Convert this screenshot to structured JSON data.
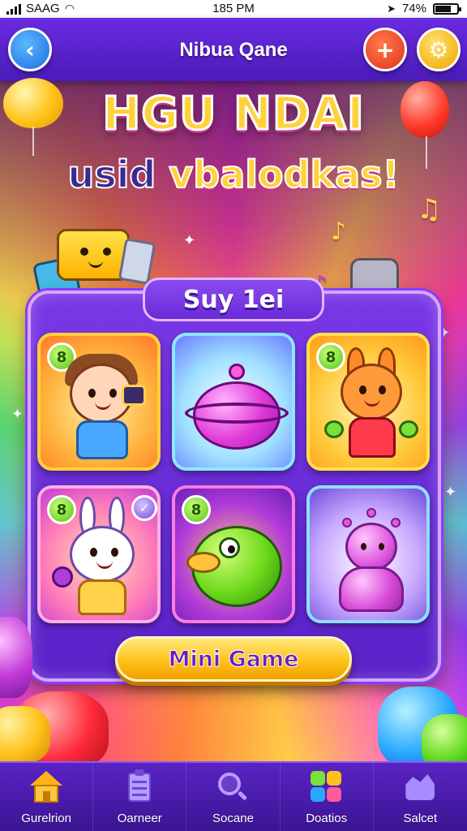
{
  "status_bar": {
    "carrier": "SAAG",
    "time": "185 PM",
    "battery": "74%",
    "battery_level": 0.74
  },
  "header": {
    "title": "Nibua Qane",
    "back_icon": "chevron-left-icon",
    "plus_icon": "plus-icon",
    "settings_icon": "gear-icon"
  },
  "banner": {
    "headline": "HGU NDAI",
    "subline_part1": "usid",
    "subline_part2": "vbalodkas!"
  },
  "panel": {
    "title": "Suy 1ei",
    "tiles": [
      {
        "badge": "8",
        "character": "kid-with-camera"
      },
      {
        "badge": "",
        "character": "magenta-pot"
      },
      {
        "badge": "8",
        "character": "orange-fox"
      },
      {
        "badge": "8",
        "character": "white-bunny"
      },
      {
        "badge": "8",
        "character": "green-dino"
      },
      {
        "badge": "",
        "character": "purple-blob"
      }
    ],
    "action_label": "Mini Game"
  },
  "bottom_nav": {
    "items": [
      {
        "label": "Gurelrion",
        "icon": "home-icon"
      },
      {
        "label": "Oarneer",
        "icon": "clipboard-icon"
      },
      {
        "label": "Socane",
        "icon": "search-icon"
      },
      {
        "label": "Doatios",
        "icon": "games-icon"
      },
      {
        "label": "Salcet",
        "icon": "cloud-icon"
      }
    ]
  },
  "colors": {
    "header_purple": "#6a2be0",
    "accent_yellow": "#ffc21a",
    "panel_purple": "#5a22c8",
    "nav_purple": "#3b1592"
  }
}
